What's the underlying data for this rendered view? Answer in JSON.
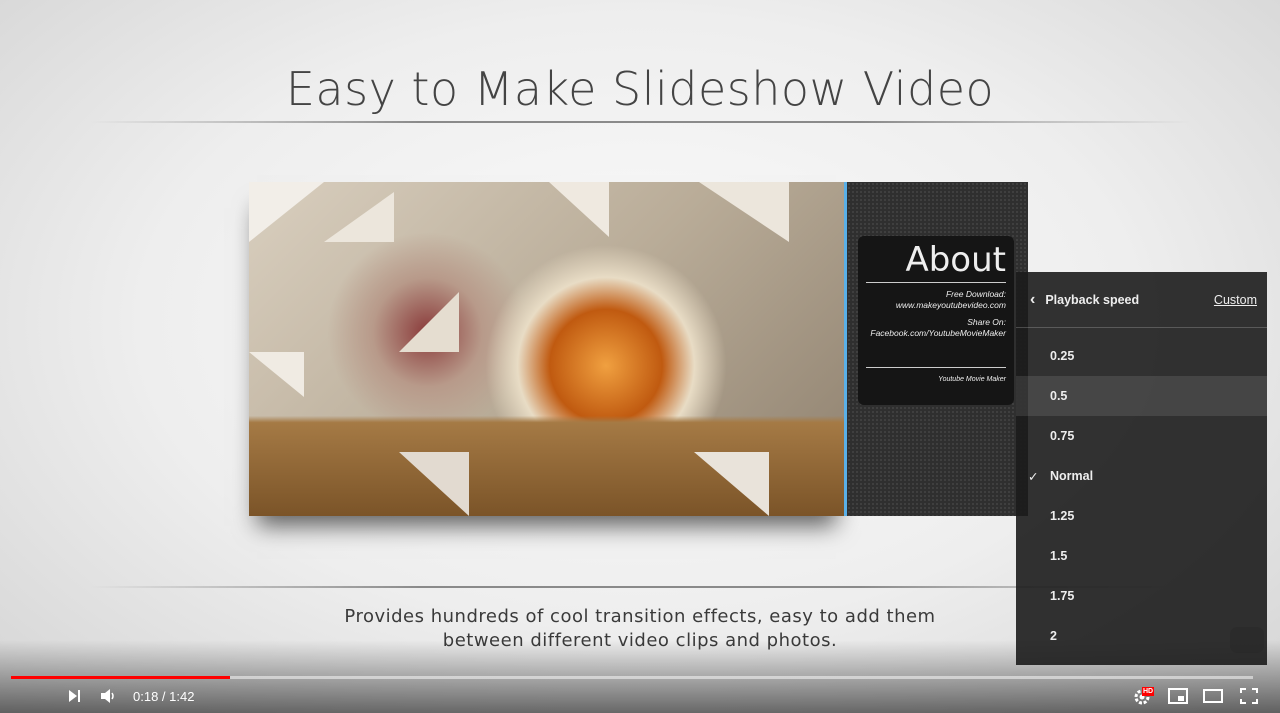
{
  "video": {
    "title": "Easy to Make Slideshow Video",
    "about": {
      "heading": "About",
      "line1": "Free Download:",
      "line2": "www.makeyoutubevideo.com",
      "line3": "Share On:",
      "line4": "Facebook.com/YoutubeMovieMaker",
      "footer": "Youtube Movie Maker"
    },
    "caption_line1": "Provides hundreds of cool transition effects, easy to add them",
    "caption_line2": "between different video clips and photos."
  },
  "player": {
    "progress_percent": 17.6,
    "time_current": "0:18",
    "time_separator": " / ",
    "time_total": "1:42",
    "hd_badge": "HD",
    "accent": "#ff0000"
  },
  "speed_menu": {
    "title": "Playback speed",
    "custom_label": "Custom",
    "check": "✓",
    "options": [
      {
        "label": "0.25"
      },
      {
        "label": "0.5"
      },
      {
        "label": "0.75"
      },
      {
        "label": "Normal"
      },
      {
        "label": "1.25"
      },
      {
        "label": "1.5"
      },
      {
        "label": "1.75"
      },
      {
        "label": "2"
      }
    ],
    "selected": "Normal",
    "hovered": "0.5"
  }
}
